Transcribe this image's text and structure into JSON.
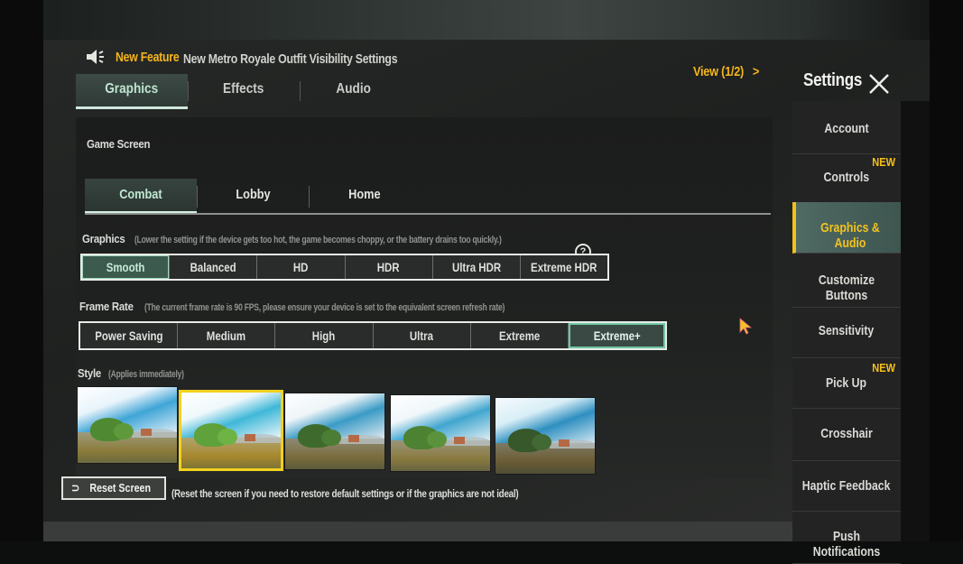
{
  "announcement": {
    "icon": "speaker-icon",
    "label": "New Feature",
    "text": "New Metro Royale Outfit Visibility Settings",
    "view_link": "View (1/2)",
    "view_chevron": "chevron-right-icon"
  },
  "top_tabs": [
    {
      "label": "Graphics",
      "active": true
    },
    {
      "label": "Effects",
      "active": false
    },
    {
      "label": "Audio",
      "active": false
    }
  ],
  "game_screen": {
    "title": "Game Screen",
    "tabs": [
      {
        "label": "Combat",
        "active": true
      },
      {
        "label": "Lobby",
        "active": false
      },
      {
        "label": "Home",
        "active": false
      }
    ]
  },
  "graphics": {
    "title": "Graphics",
    "hint": "(Lower the setting if the device gets too hot, the game becomes choppy, or the battery drains too quickly.)",
    "help_icon": "?",
    "options": [
      "Smooth",
      "Balanced",
      "HD",
      "HDR",
      "Ultra HDR",
      "Extreme HDR"
    ],
    "selected": "Smooth"
  },
  "frame_rate": {
    "title": "Frame Rate",
    "hint": "(The current frame rate is 90 FPS, please ensure your device is set to the equivalent screen refresh rate)",
    "options": [
      "Power Saving",
      "Medium",
      "High",
      "Ultra",
      "Extreme",
      "Extreme+"
    ],
    "selected": "Extreme+"
  },
  "style": {
    "title": "Style",
    "hint": "(Applies immediately)",
    "thumbnails": 5,
    "selected_index": 1
  },
  "reset": {
    "button_label": "Reset Screen",
    "icon": "undo-icon",
    "hint": "(Reset the screen if you need to restore default settings or if the graphics are not ideal)"
  },
  "settings": {
    "title": "Settings",
    "close_icon": "close-icon",
    "items": [
      {
        "label": "Account",
        "badge": ""
      },
      {
        "label": "Controls",
        "badge": "NEW"
      },
      {
        "label": "Graphics & Audio",
        "badge": "",
        "active": true
      },
      {
        "label": "Customize Buttons",
        "badge": ""
      },
      {
        "label": "Sensitivity",
        "badge": ""
      },
      {
        "label": "Pick Up",
        "badge": "NEW"
      },
      {
        "label": "Crosshair",
        "badge": ""
      },
      {
        "label": "Haptic Feedback",
        "badge": ""
      },
      {
        "label": "Push Notifications",
        "badge": ""
      }
    ]
  },
  "colors": {
    "accent_yellow": "#f5b51c",
    "accent_green": "#3c5a4d",
    "selected_border_yellow": "#f1d11f"
  }
}
